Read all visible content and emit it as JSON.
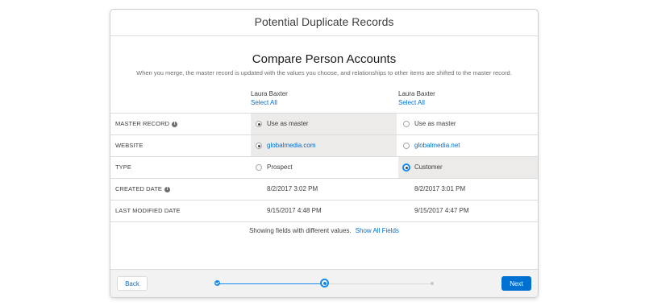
{
  "modal": {
    "title": "Potential Duplicate Records"
  },
  "compare": {
    "heading": "Compare Person Accounts",
    "subtext": "When you merge, the master record is updated with the values you choose, and relationships to other items are shifted to the master record."
  },
  "columns": [
    {
      "name": "Laura Baxter",
      "select_all": "Select All"
    },
    {
      "name": "Laura Baxter",
      "select_all": "Select All"
    }
  ],
  "rows": {
    "master_record": {
      "label": "MASTER RECORD",
      "values": [
        "Use as master",
        "Use as master"
      ],
      "selected": 0
    },
    "website": {
      "label": "WEBSITE",
      "values": [
        "globalmedia.com",
        "globalmedia.net"
      ],
      "selected": 0
    },
    "type": {
      "label": "TYPE",
      "values": [
        "Prospect",
        "Customer"
      ],
      "selected": 1
    },
    "created_date": {
      "label": "CREATED DATE",
      "values": [
        "8/2/2017 3:02 PM",
        "8/2/2017 3:01 PM"
      ]
    },
    "last_modified": {
      "label": "LAST MODIFIED DATE",
      "values": [
        "9/15/2017 4:48 PM",
        "9/15/2017 4:47 PM"
      ]
    }
  },
  "footnote": {
    "text": "Showing fields with different values.",
    "link": "Show All Fields"
  },
  "footer": {
    "back_label": "Back",
    "next_label": "Next"
  },
  "progress": {
    "steps": 3,
    "current_step": 2
  },
  "colors": {
    "accent": "#0070d2",
    "progress": "#1589ee",
    "selected_bg": "#ecebea"
  },
  "icons": {
    "info": "info-icon",
    "radio": "radio-button"
  }
}
